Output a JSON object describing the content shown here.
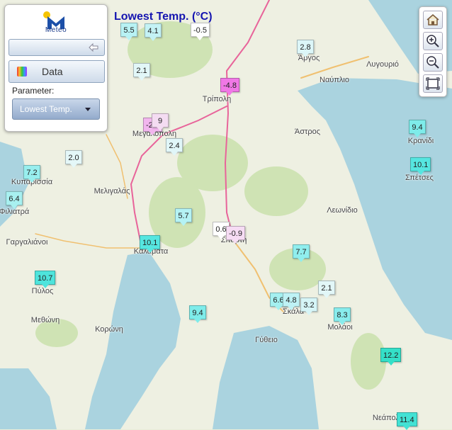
{
  "title": "Lowest Temp. (°C)",
  "panel": {
    "logo_text": "Meteo",
    "data_label": "Data",
    "parameter_label": "Parameter:",
    "parameter_value": "Lowest Temp."
  },
  "places": [
    {
      "name": "Τρίπολη"
    },
    {
      "name": "Άργος"
    },
    {
      "name": "Ναύπλιο"
    },
    {
      "name": "Λυγουριό"
    },
    {
      "name": "Μεγαλόπολη"
    },
    {
      "name": "Άστρος"
    },
    {
      "name": "Κρανίδι"
    },
    {
      "name": "Σπέτσες"
    },
    {
      "name": "Κυπαρισσία"
    },
    {
      "name": "Μελιγαλάς"
    },
    {
      "name": "Φιλιατρά"
    },
    {
      "name": "Λεωνίδιο"
    },
    {
      "name": "Γαργαλιάνοι"
    },
    {
      "name": "Καλαμάτα"
    },
    {
      "name": "Σπάρτη"
    },
    {
      "name": "Πύλος"
    },
    {
      "name": "Σκάλα"
    },
    {
      "name": "Μεθώνη"
    },
    {
      "name": "Κορώνη"
    },
    {
      "name": "Μολάοι"
    },
    {
      "name": "Γύθειο"
    },
    {
      "name": "Νεάπολη"
    }
  ],
  "markers": [
    {
      "value": "5.5",
      "color": "#b8f2f4"
    },
    {
      "value": "4.1",
      "color": "#c4f2f5"
    },
    {
      "value": "-0.5",
      "color": "#ffffff"
    },
    {
      "value": "2.8",
      "color": "#dcf6f8"
    },
    {
      "value": "2.1",
      "color": "#e2f7f8"
    },
    {
      "value": "-4.8",
      "color": "#f078e6"
    },
    {
      "value": "-2.6",
      "color": "#f2b6ee"
    },
    {
      "value": "9",
      "color": "#f4dcf2"
    },
    {
      "value": "2.4",
      "color": "#e0f6f8"
    },
    {
      "value": "9.4",
      "color": "#7eecea"
    },
    {
      "value": "2.0",
      "color": "#e4f7f8"
    },
    {
      "value": "10.1",
      "color": "#56e6e0"
    },
    {
      "value": "7.2",
      "color": "#98eeee"
    },
    {
      "value": "6.4",
      "color": "#a8f0f0"
    },
    {
      "value": "5.7",
      "color": "#b4f2f4"
    },
    {
      "value": "0.6",
      "color": "#ffffff"
    },
    {
      "value": "-0.9",
      "color": "#f6dcf4"
    },
    {
      "value": "10.1",
      "color": "#56e6e0"
    },
    {
      "value": "7.7",
      "color": "#90eeee"
    },
    {
      "value": "10.7",
      "color": "#4ee4dc"
    },
    {
      "value": "2.1",
      "color": "#e2f7f8"
    },
    {
      "value": "6.6",
      "color": "#a4f0f0"
    },
    {
      "value": "4.8",
      "color": "#bef2f5"
    },
    {
      "value": "3.2",
      "color": "#d6f5f7"
    },
    {
      "value": "9.4",
      "color": "#7eecea"
    },
    {
      "value": "8.3",
      "color": "#88ecec"
    },
    {
      "value": "12.2",
      "color": "#34e0c8"
    },
    {
      "value": "11.4",
      "color": "#42e2d4"
    }
  ]
}
